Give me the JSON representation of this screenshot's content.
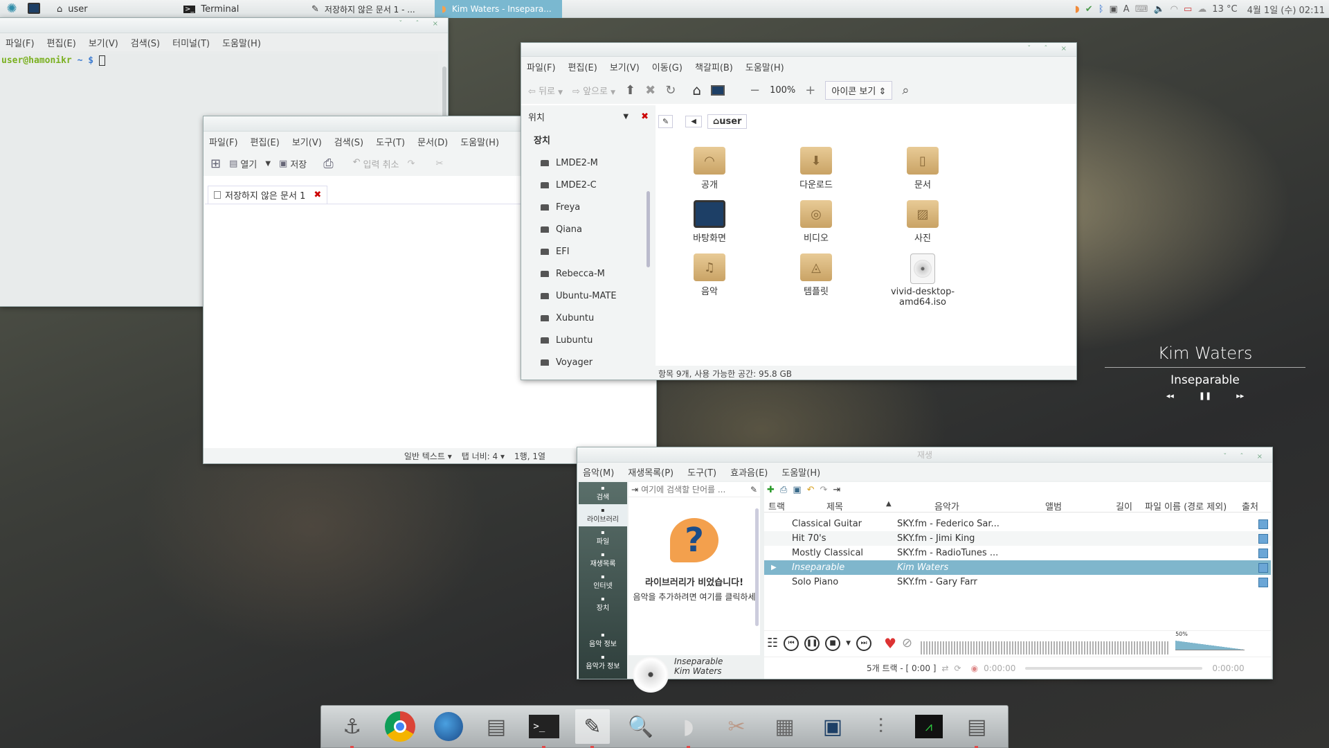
{
  "panel": {
    "tasks": [
      {
        "label": "user"
      },
      {
        "label": "Terminal"
      },
      {
        "label": "저장하지 않은 문서 1 - ..."
      },
      {
        "label": "Kim Waters - Insepara..."
      }
    ],
    "weather": "13 °C",
    "clock": "4월 1일 (수) 02:11",
    "ime": "A"
  },
  "terminal": {
    "menu": [
      "파일(F)",
      "편집(E)",
      "보기(V)",
      "검색(S)",
      "터미널(T)",
      "도움말(H)"
    ],
    "prompt_user": "user@hamonikr",
    "prompt_path": "~ $"
  },
  "editor": {
    "menu": [
      "파일(F)",
      "편집(E)",
      "보기(V)",
      "검색(S)",
      "도구(T)",
      "문서(D)",
      "도움말(H)"
    ],
    "tb_open": "열기",
    "tb_save": "저장",
    "tb_undo": "입력 취소",
    "tab": "저장하지 않은 문서 1",
    "status_lang": "일반 텍스트",
    "status_tab": "탭 너비: 4",
    "status_pos": "1행, 1열"
  },
  "files": {
    "menu": [
      "파일(F)",
      "편집(E)",
      "보기(V)",
      "이동(G)",
      "책갈피(B)",
      "도움말(H)"
    ],
    "back": "뒤로",
    "forward": "앞으로",
    "zoom": "100%",
    "view": "아이콘 보기",
    "location_label": "위치",
    "crumb": "user",
    "side_header": "장치",
    "devices": [
      "LMDE2-M",
      "LMDE2-C",
      "Freya",
      "Qiana",
      "EFI",
      "Rebecca-M",
      "Ubuntu-MATE",
      "Xubuntu",
      "Lubuntu",
      "Voyager"
    ],
    "items": [
      "공개",
      "다운로드",
      "문서",
      "바탕화면",
      "비디오",
      "사진",
      "음악",
      "템플릿",
      "vivid-desktop-amd64.iso"
    ],
    "status": "항목 9개, 사용 가능한 공간: 95.8 GB"
  },
  "widget": {
    "artist": "Kim Waters",
    "title": "Inseparable"
  },
  "player": {
    "title": "재생",
    "menu": [
      "음악(M)",
      "재생목록(P)",
      "도구(T)",
      "효과음(E)",
      "도움말(H)"
    ],
    "side": [
      "검색",
      "라이브러리",
      "파일",
      "재생목록",
      "인터넷",
      "장치",
      "음악 정보",
      "음악가 정보"
    ],
    "search_placeholder": "여기에 검색할 단어를 ...",
    "empty_title": "라이브러리가 비었습니다!",
    "empty_sub": "음악을 추가하려면 여기를 클릭하세",
    "now_title": "Inseparable",
    "now_artist": "Kim Waters",
    "columns": [
      "트랙",
      "제목",
      "음악가",
      "앨범",
      "길이",
      "파일 이름 (경로 제외)",
      "출처"
    ],
    "rows": [
      {
        "title": "Classical Guitar",
        "artist": "SKY.fm - Federico Sar..."
      },
      {
        "title": "Hit 70's",
        "artist": "SKY.fm - Jimi King"
      },
      {
        "title": "Mostly Classical",
        "artist": "SKY.fm - RadioTunes ..."
      },
      {
        "title": "Inseparable",
        "artist": "Kim Waters"
      },
      {
        "title": "Solo Piano",
        "artist": "SKY.fm - Gary Farr"
      }
    ],
    "volume": "50%",
    "summary": "5개 트랙 - [ 0:00 ]",
    "time_start": "0:00:00",
    "time_end": "0:00:00"
  },
  "colors": {
    "accent": "#7ab8d0",
    "highlight": "#7fb6cc",
    "folder": "#d9b77d",
    "dock_dot": "#e04a4a"
  }
}
